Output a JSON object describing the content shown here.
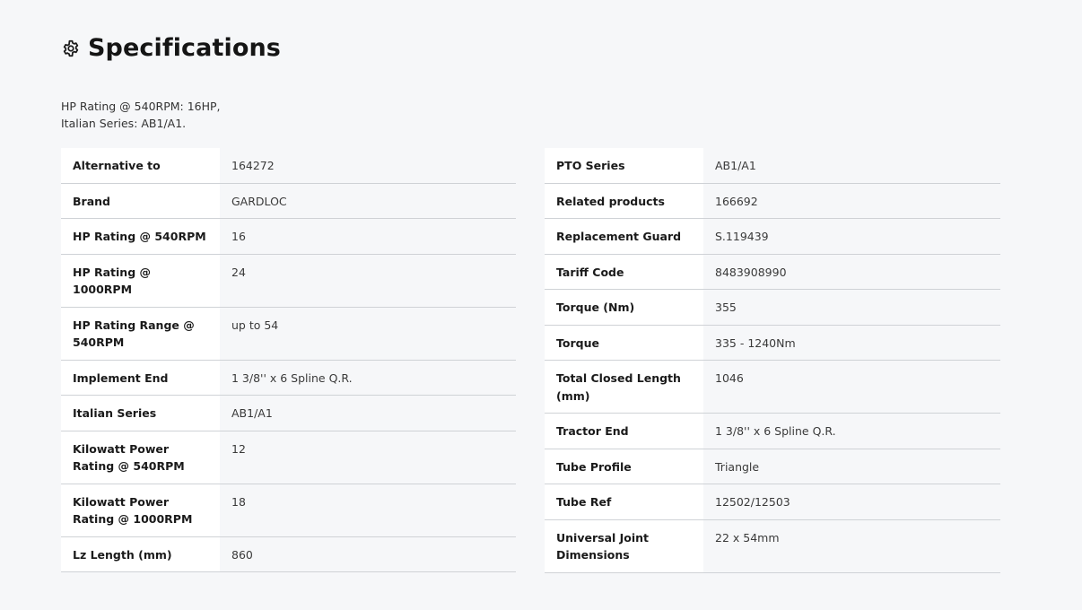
{
  "section": {
    "title": "Specifications",
    "icon": "gear-icon"
  },
  "summary": {
    "line1": "HP Rating @ 540RPM: 16HP,",
    "line2": "Italian Series: AB1/A1."
  },
  "left_table": [
    {
      "key": "Alternative to",
      "value": "164272"
    },
    {
      "key": "Brand",
      "value": "GARDLOC"
    },
    {
      "key": "HP Rating @ 540RPM",
      "value": "16"
    },
    {
      "key": "HP Rating @ 1000RPM",
      "value": "24"
    },
    {
      "key": "HP Rating Range @ 540RPM",
      "value": "up to 54"
    },
    {
      "key": "Implement End",
      "value": "1 3/8'' x 6 Spline Q.R."
    },
    {
      "key": "Italian Series",
      "value": "AB1/A1"
    },
    {
      "key": "Kilowatt Power Rating @ 540RPM",
      "value": "12"
    },
    {
      "key": "Kilowatt Power Rating @ 1000RPM",
      "value": "18"
    },
    {
      "key": "Lz Length (mm)",
      "value": "860"
    }
  ],
  "right_table": [
    {
      "key": "PTO Series",
      "value": "AB1/A1"
    },
    {
      "key": "Related products",
      "value": "166692"
    },
    {
      "key": "Replacement Guard",
      "value": "S.119439"
    },
    {
      "key": "Tariff Code",
      "value": "8483908990"
    },
    {
      "key": "Torque (Nm)",
      "value": "355"
    },
    {
      "key": "Torque",
      "value": "335 - 1240Nm"
    },
    {
      "key": "Total Closed Length (mm)",
      "value": "1046"
    },
    {
      "key": "Tractor End",
      "value": "1 3/8'' x 6 Spline Q.R."
    },
    {
      "key": "Tube Profile",
      "value": "Triangle"
    },
    {
      "key": "Tube Ref",
      "value": "12502/12503"
    },
    {
      "key": "Universal Joint Dimensions",
      "value": "22 x 54mm"
    }
  ]
}
